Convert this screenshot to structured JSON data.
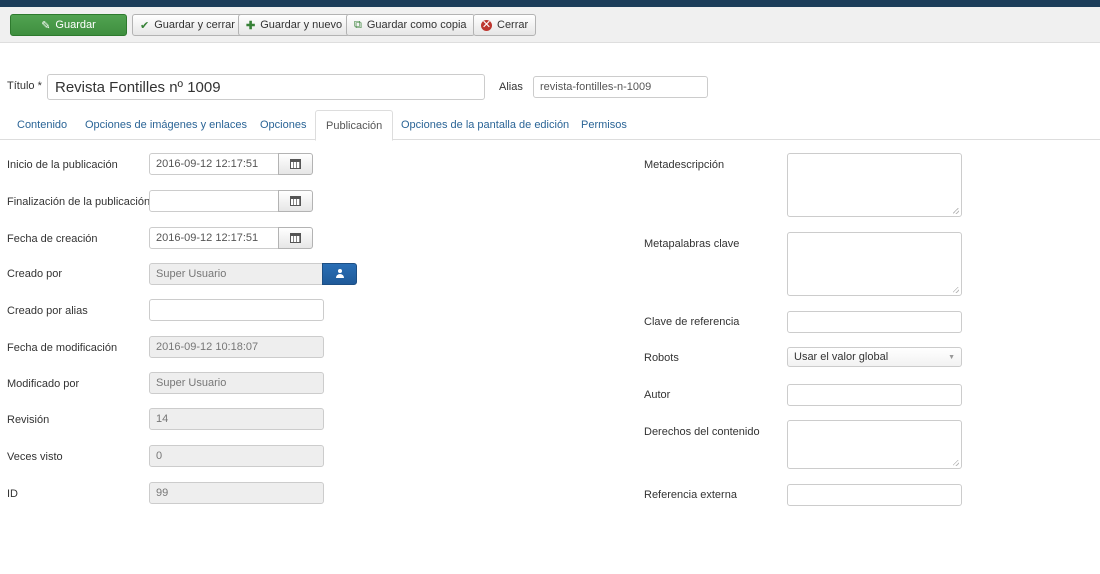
{
  "toolbar": {
    "save": "Guardar",
    "save_close": "Guardar y cerrar",
    "save_new": "Guardar y nuevo",
    "save_copy": "Guardar como copia",
    "close": "Cerrar"
  },
  "header": {
    "title_label": "Título *",
    "title_value": "Revista Fontilles nº 1009",
    "alias_label": "Alias",
    "alias_value": "revista-fontilles-n-1009"
  },
  "tabs": [
    {
      "label": "Contenido"
    },
    {
      "label": "Opciones de imágenes y enlaces"
    },
    {
      "label": "Opciones"
    },
    {
      "label": "Publicación"
    },
    {
      "label": "Opciones de la pantalla de edición"
    },
    {
      "label": "Permisos"
    }
  ],
  "left": {
    "publish_up_label": "Inicio de la publicación",
    "publish_up_value": "2016-09-12 12:17:51",
    "publish_down_label": "Finalización de la publicación",
    "publish_down_value": "",
    "created_label": "Fecha de creación",
    "created_value": "2016-09-12 12:17:51",
    "created_by_label": "Creado por",
    "created_by_value": "Super Usuario",
    "created_by_alias_label": "Creado por alias",
    "created_by_alias_value": "",
    "modified_label": "Fecha de modificación",
    "modified_value": "2016-09-12 10:18:07",
    "modified_by_label": "Modificado por",
    "modified_by_value": "Super Usuario",
    "revision_label": "Revisión",
    "revision_value": "14",
    "hits_label": "Veces visto",
    "hits_value": "0",
    "id_label": "ID",
    "id_value": "99"
  },
  "right": {
    "metadesc_label": "Metadescripción",
    "metakey_label": "Metapalabras clave",
    "xreference_label": "Clave de referencia",
    "robots_label": "Robots",
    "robots_value": "Usar el valor global",
    "author_label": "Autor",
    "rights_label": "Derechos del contenido",
    "external_ref_label": "Referencia externa"
  },
  "colors": {
    "topbar": "#1c3d5a",
    "primary_button": "#46a546",
    "user_button": "#2a6fb5",
    "link": "#2a6496"
  }
}
